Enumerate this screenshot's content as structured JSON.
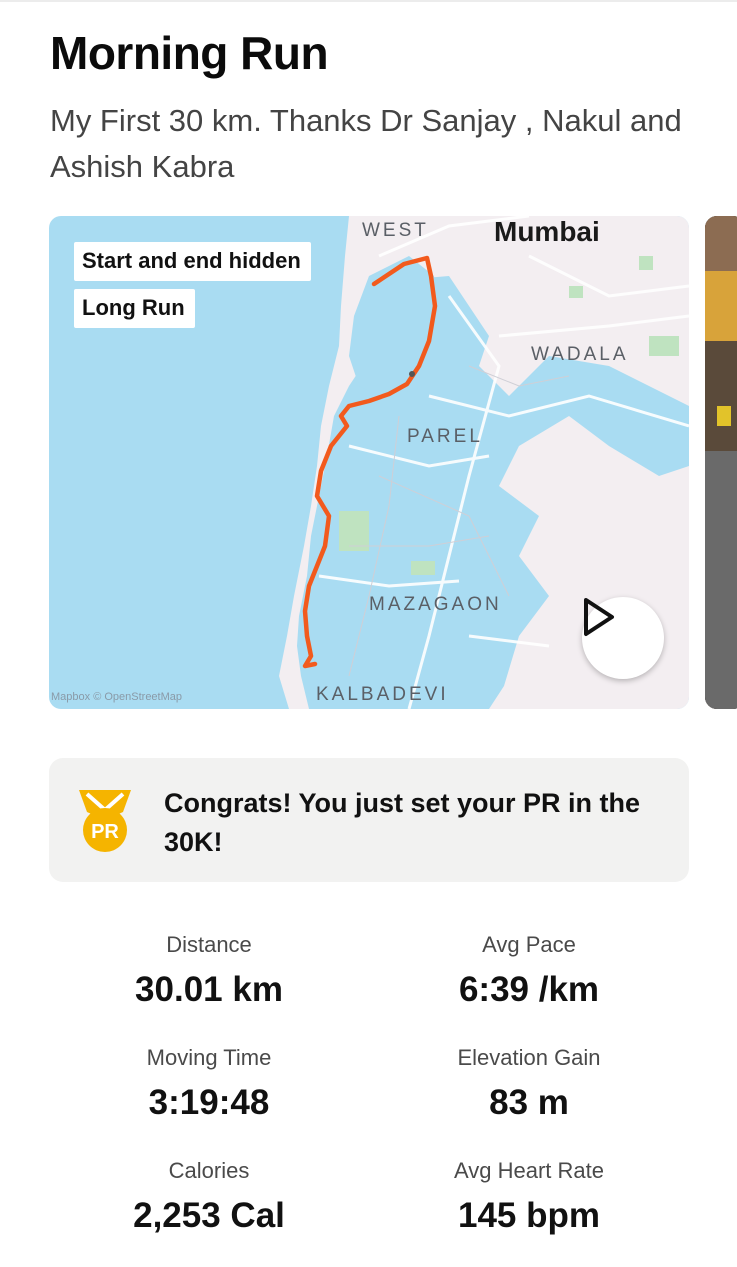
{
  "activity": {
    "title": "Morning Run",
    "description": "My First 30 km. Thanks Dr Sanjay , Nakul and Ashish Kabra"
  },
  "map": {
    "tags": [
      "Start and end hidden",
      "Long Run"
    ],
    "city_label": "Mumbai",
    "area_labels": {
      "west": "WEST",
      "wadala": "WADALA",
      "parel": "PAREL",
      "mazagaon": "MAZAGAON",
      "kalbadevi": "KALBADEVI"
    },
    "attribution": "Mapbox © OpenStreetMap",
    "route_color": "#f25a1d",
    "water_color": "#a9dcf2",
    "land_color": "#f3eef1"
  },
  "pr_banner": {
    "text": "Congrats! You just set your PR in the 30K!",
    "badge_text": "PR",
    "icon": "medal-icon"
  },
  "stats": [
    {
      "label": "Distance",
      "value": "30.01 km"
    },
    {
      "label": "Avg Pace",
      "value": "6:39 /km"
    },
    {
      "label": "Moving Time",
      "value": "3:19:48"
    },
    {
      "label": "Elevation Gain",
      "value": "83 m"
    },
    {
      "label": "Calories",
      "value": "2,253 Cal"
    },
    {
      "label": "Avg Heart Rate",
      "value": "145 bpm"
    }
  ]
}
